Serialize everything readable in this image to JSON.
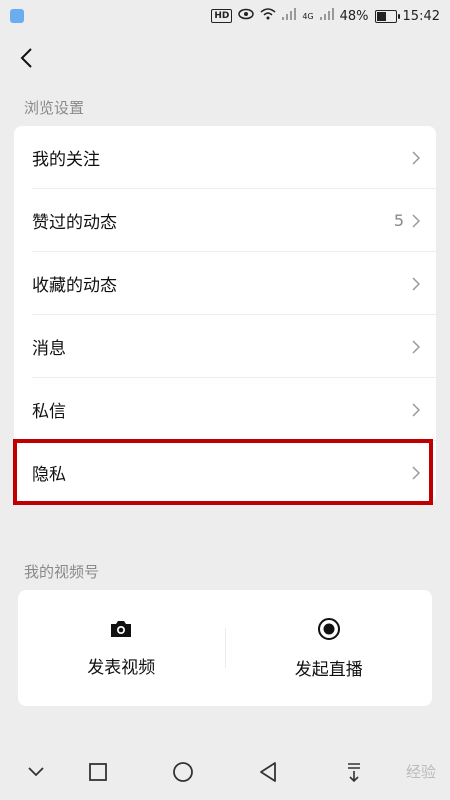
{
  "status_bar": {
    "battery": "48%",
    "battery_level": 0.48,
    "time": "15:42",
    "network": "4G",
    "hd": "HD"
  },
  "sections": {
    "browse_title": "浏览设置",
    "video_title": "我的视频号"
  },
  "settings_items": [
    {
      "label": "我的关注",
      "badge": ""
    },
    {
      "label": "赞过的动态",
      "badge": "5"
    },
    {
      "label": "收藏的动态",
      "badge": ""
    },
    {
      "label": "消息",
      "badge": ""
    },
    {
      "label": "私信",
      "badge": ""
    },
    {
      "label": "隐私",
      "badge": ""
    }
  ],
  "video_actions": {
    "post_video": "发表视频",
    "start_live": "发起直播"
  },
  "watermark": "经验",
  "icons": {
    "back": "back-arrow-icon",
    "chevron": "chevron-right-icon",
    "camera": "camera-icon",
    "live": "live-record-icon"
  },
  "colors": {
    "highlight_border": "#c00000"
  }
}
